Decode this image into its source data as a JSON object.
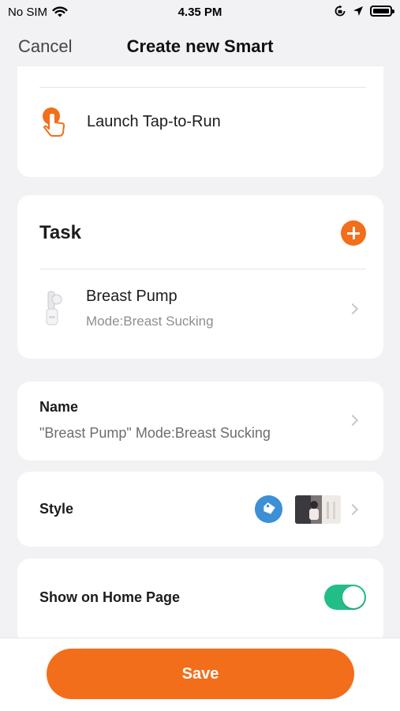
{
  "status_bar": {
    "carrier": "No SIM",
    "time": "4.35 PM"
  },
  "nav": {
    "cancel_label": "Cancel",
    "title": "Create new Smart"
  },
  "condition": {
    "icon": "tap-hand-icon",
    "label": "Launch Tap-to-Run"
  },
  "task": {
    "title": "Task",
    "add_icon": "plus-icon",
    "item": {
      "name": "Breast Pump",
      "mode": "Mode:Breast Sucking"
    }
  },
  "name_section": {
    "label": "Name",
    "value": "\"Breast Pump\" Mode:Breast Sucking"
  },
  "style_section": {
    "label": "Style",
    "tag_icon": "tag-icon",
    "tag_color": "#3d8fd6"
  },
  "home_section": {
    "label": "Show on Home Page",
    "enabled": true
  },
  "footer": {
    "save_label": "Save"
  },
  "colors": {
    "accent": "#f36e1a",
    "toggle_on": "#23be87",
    "background": "#f2f2f4"
  }
}
